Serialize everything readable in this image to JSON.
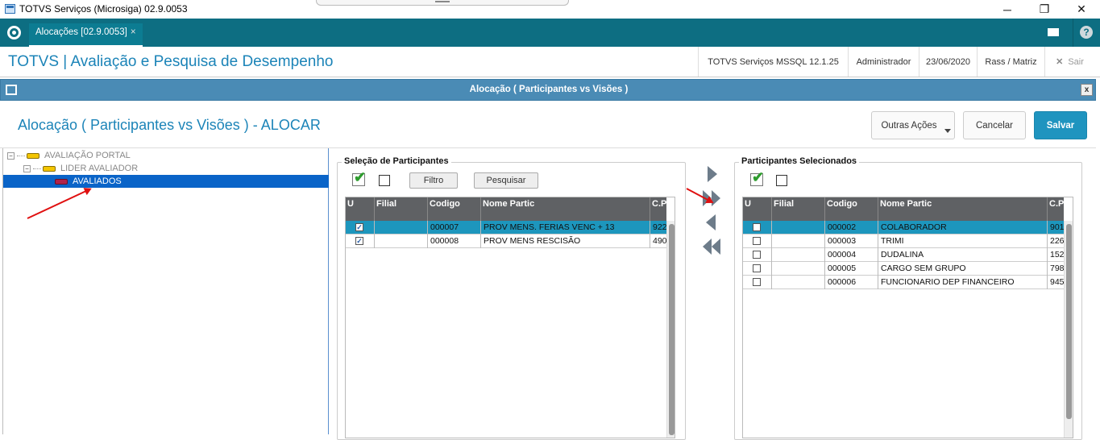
{
  "window": {
    "title": "TOTVS Serviços (Microsiga) 02.9.0053",
    "minimize": "─",
    "restore": "❐",
    "close": "✕"
  },
  "tabbar": {
    "tab_label": "Alocações [02.9.0053]",
    "tab_close": "×",
    "help": "?"
  },
  "app_header": {
    "title": "TOTVS | Avaliação e Pesquisa de Desempenho",
    "server": "TOTVS Serviços MSSQL 12.1.25",
    "user": "Administrador",
    "date": "23/06/2020",
    "branch": "Rass / Matriz",
    "exit": "Sair"
  },
  "dialog": {
    "header_title": "Alocação ( Participantes vs Visões )",
    "close": "x",
    "title": "Alocação ( Participantes vs Visões ) - ALOCAR",
    "buttons": {
      "other_actions": "Outras Ações",
      "cancel": "Cancelar",
      "save": "Salvar"
    }
  },
  "tree": {
    "nodes": [
      {
        "label": "AVALIAÇÃO PORTAL",
        "expander": "−"
      },
      {
        "label": "LIDER AVALIADOR",
        "expander": "−"
      },
      {
        "label": "AVALIADOS"
      }
    ]
  },
  "left_panel": {
    "title": "Seleção de Participantes",
    "filter_button": "Filtro",
    "search_button": "Pesquisar",
    "columns": [
      "U",
      "Filial",
      "Codigo",
      "Nome  Partic",
      "C.P"
    ],
    "rows": [
      {
        "checked": "✓",
        "filial": "",
        "codigo": "000007",
        "nome": "PROV MENS. FERIAS VENC + 13",
        "cp": "922",
        "selected": true
      },
      {
        "checked": "✓",
        "filial": "",
        "codigo": "000008",
        "nome": "PROV MENS RESCISÃO",
        "cp": "490",
        "selected": false
      }
    ]
  },
  "right_panel": {
    "title": "Participantes Selecionados",
    "columns": [
      "U",
      "Filial",
      "Codigo",
      "Nome  Partic",
      "C.P"
    ],
    "rows": [
      {
        "checked": "",
        "filial": "",
        "codigo": "000002",
        "nome": "COLABORADOR",
        "cp": "901",
        "selected": true
      },
      {
        "checked": "",
        "filial": "",
        "codigo": "000003",
        "nome": "TRIMI",
        "cp": "226",
        "selected": false
      },
      {
        "checked": "",
        "filial": "",
        "codigo": "000004",
        "nome": "DUDALINA",
        "cp": "152",
        "selected": false
      },
      {
        "checked": "",
        "filial": "",
        "codigo": "000005",
        "nome": "CARGO SEM GRUPO",
        "cp": "798",
        "selected": false
      },
      {
        "checked": "",
        "filial": "",
        "codigo": "000006",
        "nome": "FUNCIONARIO DEP FINANCEIRO",
        "cp": "945",
        "selected": false
      }
    ]
  },
  "colors": {
    "teal_bar": "#0d6e82",
    "accent_blue": "#1c84b8",
    "dialog_header": "#4a8bb5",
    "selected_row": "#1d96bd",
    "annotation_arrow": "#e01010"
  }
}
